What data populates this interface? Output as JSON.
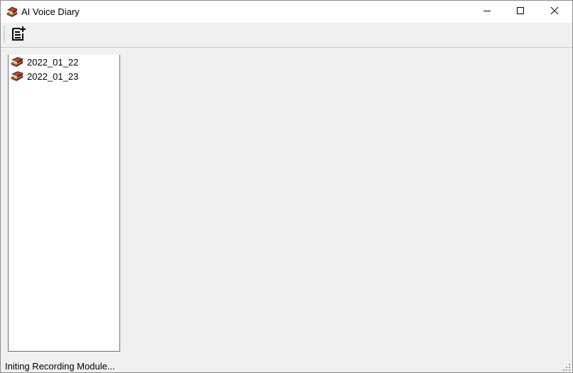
{
  "window": {
    "title": "AI Voice Diary",
    "icon": "books-icon"
  },
  "caption_buttons": [
    "minimize-icon",
    "maximize-icon",
    "close-icon"
  ],
  "toolbar": {
    "buttons": [
      {
        "icon": "new-note-icon"
      }
    ]
  },
  "sidebar": {
    "items": [
      {
        "label": "2022_01_22",
        "icon": "book-icon"
      },
      {
        "label": "2022_01_23",
        "icon": "book-icon"
      }
    ]
  },
  "status": {
    "text": "Initing Recording Module..."
  }
}
